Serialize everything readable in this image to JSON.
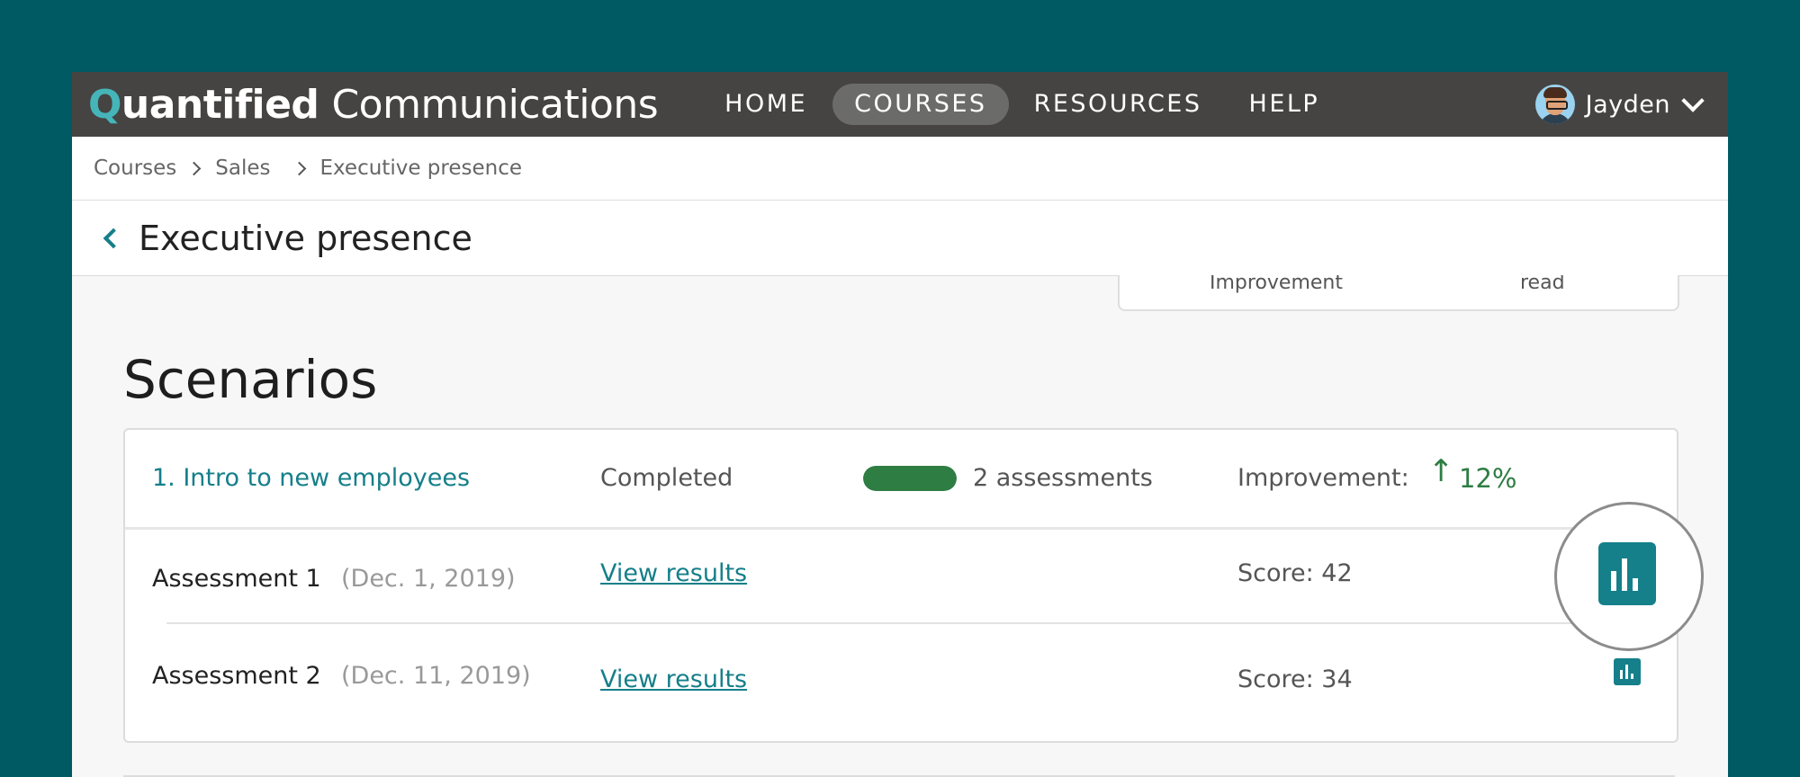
{
  "brand": {
    "logo_q": "Q",
    "logo_bold": "uantified",
    "logo_light": "Communications"
  },
  "nav": {
    "items": [
      {
        "label": "HOME",
        "active": false
      },
      {
        "label": "COURSES",
        "active": true
      },
      {
        "label": "RESOURCES",
        "active": false
      },
      {
        "label": "HELP",
        "active": false
      }
    ]
  },
  "user": {
    "name": "Jayden"
  },
  "breadcrumb": [
    "Courses",
    "Sales",
    "Executive presence"
  ],
  "page": {
    "title": "Executive presence"
  },
  "stat_card": {
    "label_1": "Improvement",
    "label_2": "read"
  },
  "section": {
    "title": "Scenarios"
  },
  "scenario": {
    "name": "1. Intro to new employees",
    "status": "Completed",
    "progress": 1.0,
    "assessments": "2 assessments",
    "improvement_label": "Improvement:",
    "improvement_arrow": "↑",
    "improvement_value": "12%",
    "rows": [
      {
        "name": "Assessment 1",
        "date": "(Dec. 1, 2019)",
        "link": "View results",
        "score": "Score: 42"
      },
      {
        "name": "Assessment 2",
        "date": "(Dec. 11, 2019)",
        "link": "View results",
        "score": "Score: 34"
      }
    ]
  },
  "colors": {
    "accent": "#157f8a",
    "positive": "#2e7d43",
    "nav_bg": "#454442",
    "page_bg": "#005a63"
  },
  "icons": [
    "chevron-down-icon",
    "chevron-left-icon",
    "chevron-right-icon",
    "bar-chart-icon"
  ]
}
